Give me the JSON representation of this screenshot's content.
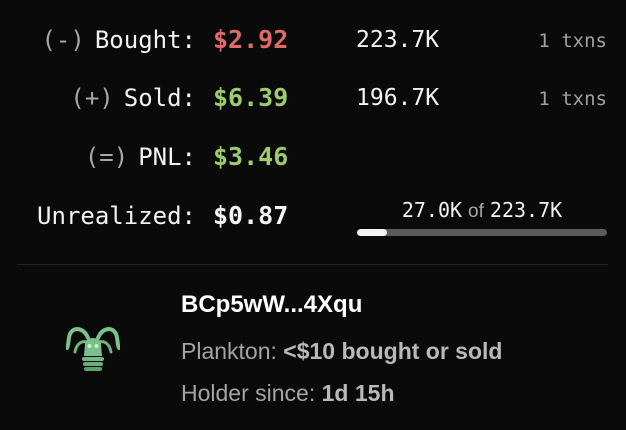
{
  "trades": {
    "bought": {
      "sign": "(-)",
      "label": "Bought:",
      "value": "$2.92",
      "amount": "223.7K",
      "txns": "1 txns",
      "value_color": "#e06a6a"
    },
    "sold": {
      "sign": "(+)",
      "label": "Sold:",
      "value": "$6.39",
      "amount": "196.7K",
      "txns": "1 txns",
      "value_color": "#9ccc6c"
    },
    "pnl": {
      "sign": "(=)",
      "label": "PNL:",
      "value": "$3.46",
      "value_color": "#9ccc6c"
    },
    "unrealized": {
      "label": "Unrealized:",
      "value": "$0.87",
      "held": "27.0K",
      "of": "of",
      "total": "223.7K",
      "held_fraction": 0.121
    }
  },
  "holder": {
    "address": "BCp5wW...4Xqu",
    "avatar_icon": "plankton-icon",
    "tier_label": "Plankton:",
    "tier_desc": "<$10 bought or sold",
    "since_label": "Holder since:",
    "since_value": "1d 15h"
  }
}
